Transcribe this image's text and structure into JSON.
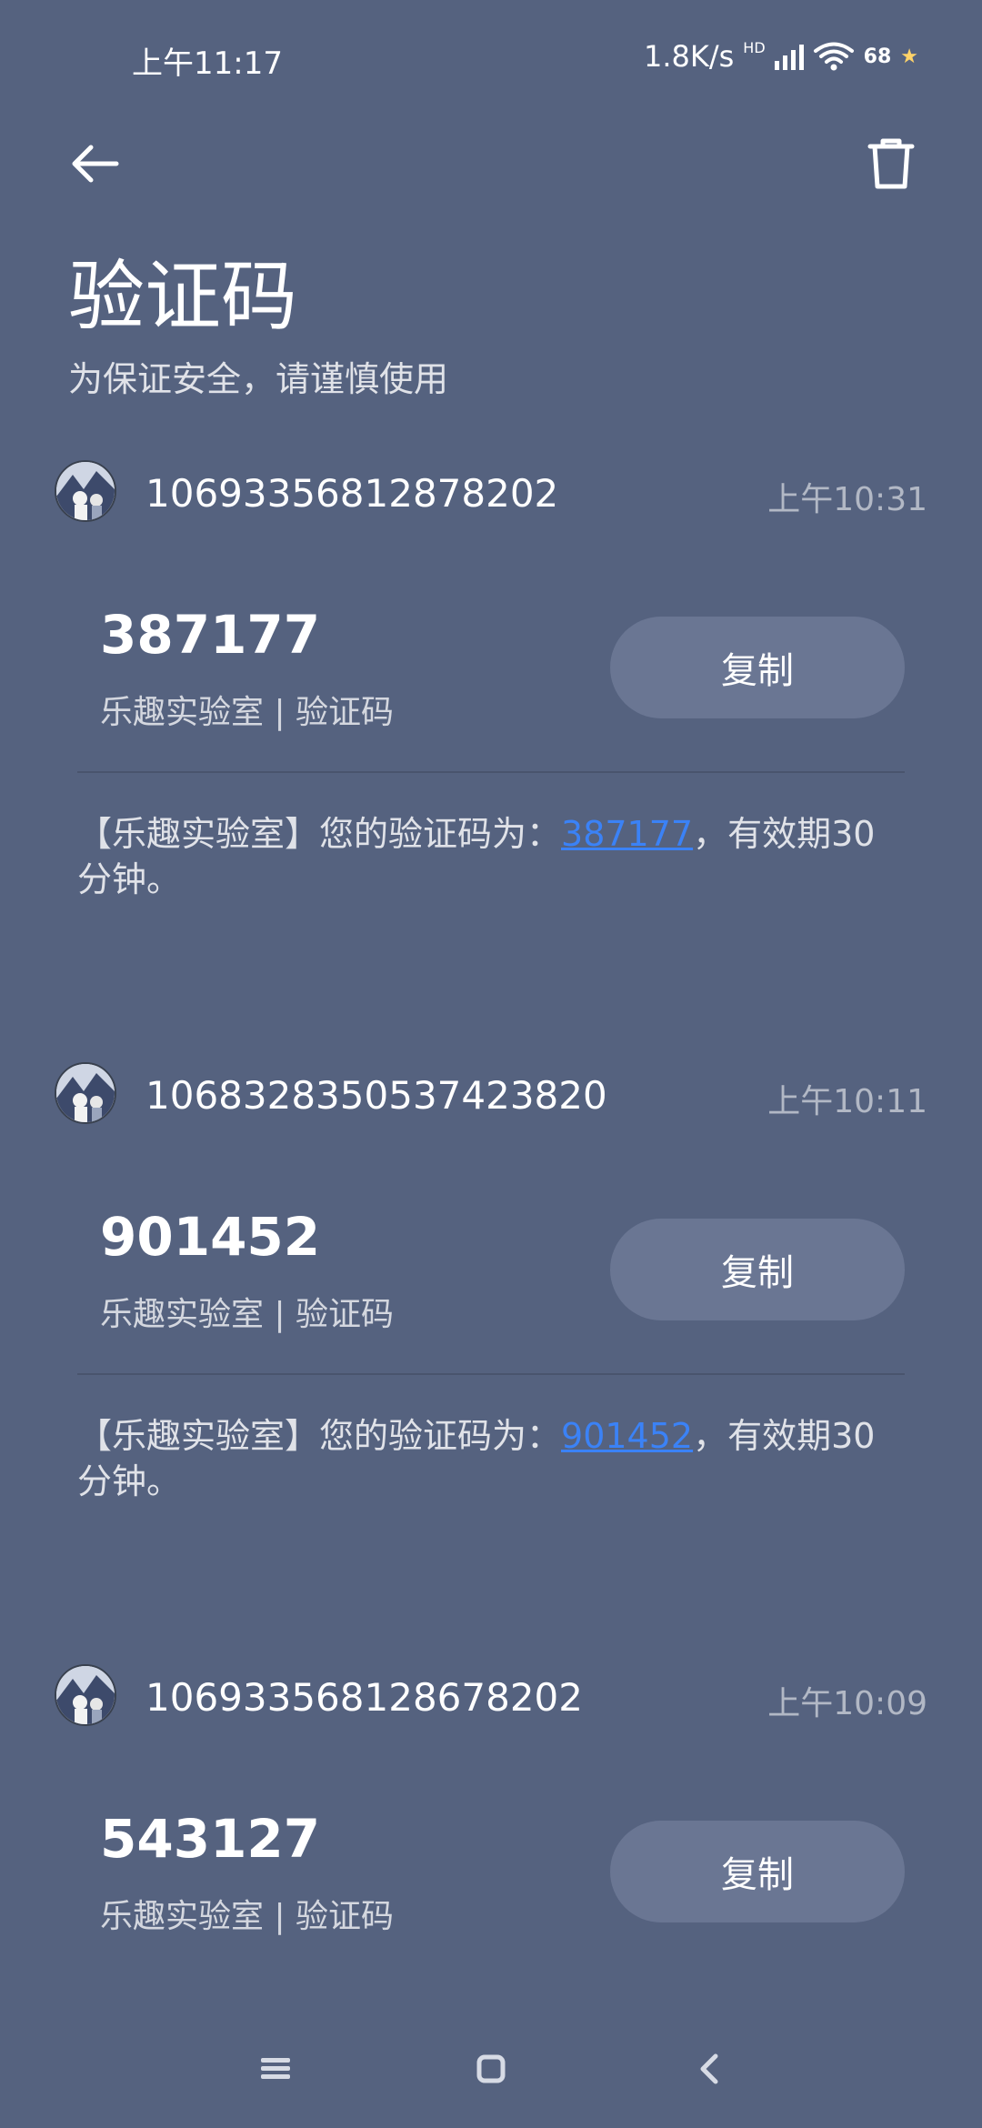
{
  "status": {
    "time": "上午11:17",
    "net_speed": "1.8K/s",
    "hd_label": "HD",
    "battery": "68",
    "wifi_icon": "wifi-icon",
    "signal_icon": "signal-icon"
  },
  "header": {
    "title": "验证码",
    "subtitle": "为保证安全，请谨慎使用",
    "back_icon": "back-arrow-icon",
    "delete_icon": "trash-icon"
  },
  "messages": [
    {
      "sender": "10693356812878202",
      "time": "上午10:31",
      "code": "387177",
      "tag": "乐趣实验室 | 验证码",
      "copy_label": "复制",
      "body_prefix": "【乐趣实验室】您的验证码为：",
      "body_code": "387177",
      "body_suffix": "，有效期30分钟。"
    },
    {
      "sender": "106832835053742382​0",
      "time": "上午10:11",
      "code": "901452",
      "tag": "乐趣实验室 | 验证码",
      "copy_label": "复制",
      "body_prefix": "【乐趣实验室】您的验证码为：",
      "body_code": "901452",
      "body_suffix": "，有效期30分钟。"
    },
    {
      "sender": "10693356812867820​2",
      "time": "上午10:09",
      "code": "543127",
      "tag": "乐趣实验室 | 验证码",
      "copy_label": "复制"
    }
  ],
  "colors": {
    "background": "#55627f",
    "button": "#6a7693",
    "link": "#3b82f6"
  }
}
